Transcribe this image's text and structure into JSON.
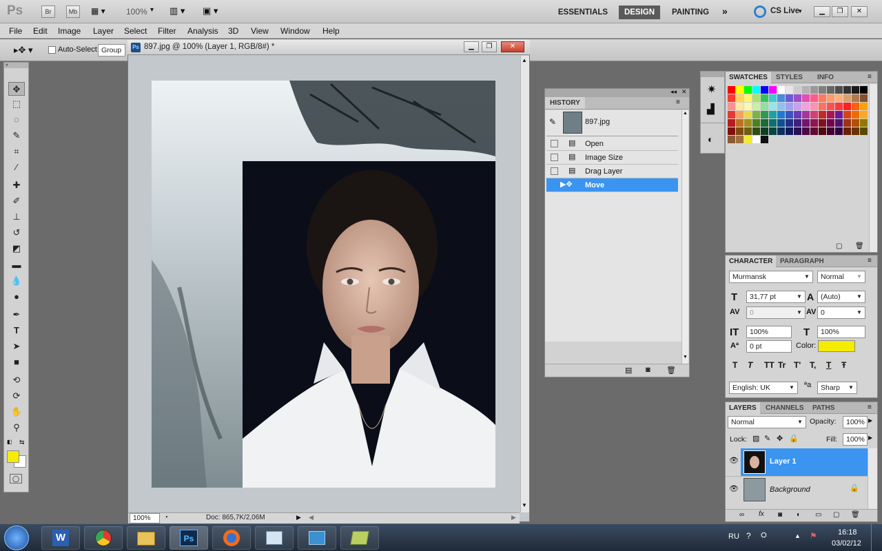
{
  "appbar": {
    "logo": "Ps",
    "br_label": "Br",
    "mb_label": "Mb",
    "zoom": "100%",
    "workspaces": [
      "ESSENTIALS",
      "DESIGN",
      "PAINTING"
    ],
    "cs_live": "CS Live"
  },
  "menu": [
    "File",
    "Edit",
    "Image",
    "Layer",
    "Select",
    "Filter",
    "Analysis",
    "3D",
    "View",
    "Window",
    "Help"
  ],
  "options": {
    "auto_select_label": "Auto-Select:",
    "auto_select_value": "Group"
  },
  "document": {
    "title": "897.jpg @ 100% (Layer 1, RGB/8#) *",
    "zoom": "100%",
    "doc_info": "Doc: 865,7K/2,06M"
  },
  "history": {
    "tab": "HISTORY",
    "snapshot": "897.jpg",
    "items": [
      "Open",
      "Image Size",
      "Drag Layer",
      "Move"
    ]
  },
  "swatches_panel": {
    "tabs": [
      "SWATCHES",
      "STYLES",
      "INFO"
    ]
  },
  "character": {
    "tabs": [
      "CHARACTER",
      "PARAGRAPH"
    ],
    "font_family": "Murmansk",
    "font_style": "Normal",
    "size": "31,77 pt",
    "leading": "(Auto)",
    "kerning": "0",
    "tracking": "0",
    "vscale": "100%",
    "hscale": "100%",
    "baseline": "0 pt",
    "color_label": "Color:",
    "color_value": "#f5ec00",
    "language": "English: UK",
    "aa_label": "a",
    "antialias": "Sharp",
    "style_buttons": [
      "T",
      "T",
      "TT",
      "Tr",
      "T'",
      "T,",
      "T",
      "Ŧ"
    ]
  },
  "layers": {
    "tabs": [
      "LAYERS",
      "CHANNELS",
      "PATHS"
    ],
    "blend_mode": "Normal",
    "opacity_label": "Opacity:",
    "opacity": "100%",
    "lock_label": "Lock:",
    "fill_label": "Fill:",
    "fill": "100%",
    "items": [
      {
        "name": "Layer 1",
        "selected": true
      },
      {
        "name": "Background",
        "selected": false
      }
    ]
  },
  "taskbar": {
    "lang": "RU",
    "time": "16:18",
    "date": "03/02/12",
    "apps": [
      "word",
      "chrome",
      "explorer",
      "photoshop",
      "firefox",
      "mail",
      "control-panel",
      "notes"
    ]
  },
  "colors": {
    "selection": "#3a94f0",
    "foreground": "#f5ec00",
    "background": "#ffffff"
  }
}
